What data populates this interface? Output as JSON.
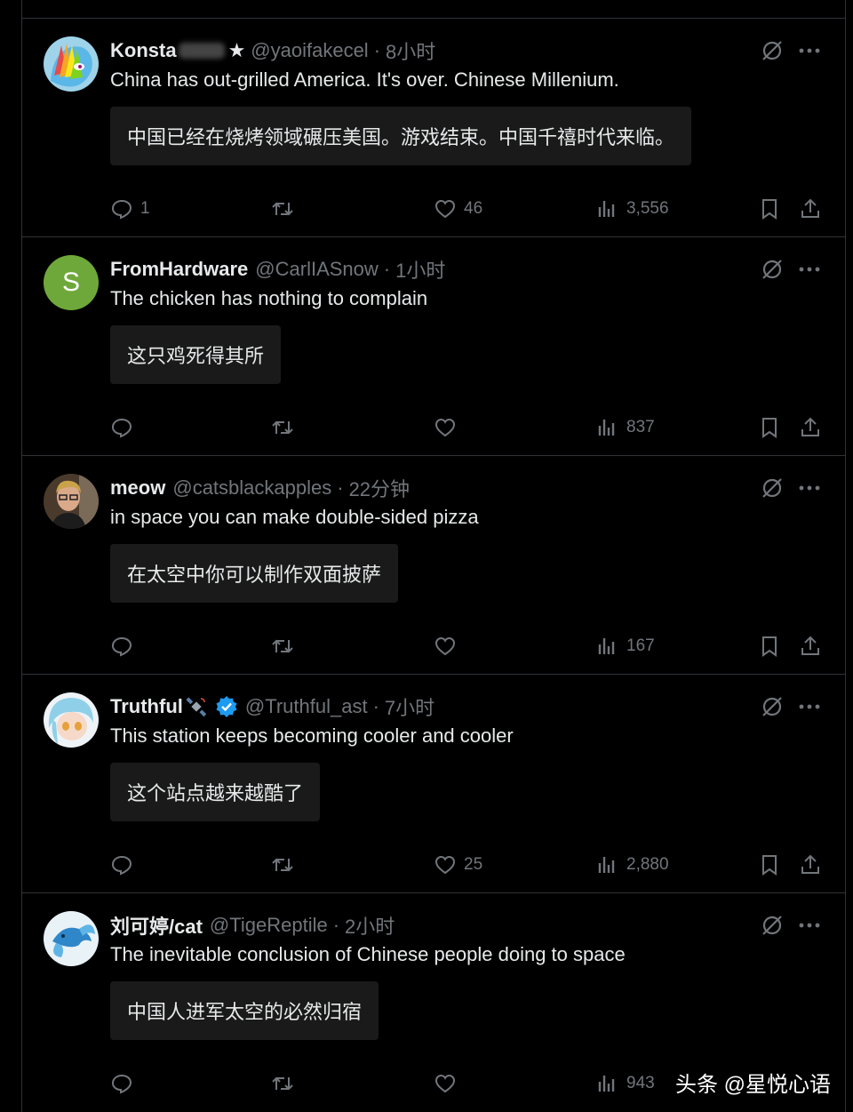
{
  "tweets": [
    {
      "name": "Konsta",
      "handle": "@yaoifakecel",
      "time": "8小时",
      "text": "China has out-grilled America. It's over. Chinese Millenium.",
      "translation": "中国已经在烧烤领域碾压美国。游戏结束。中国千禧时代来临。",
      "replies": "1",
      "likes": "46",
      "views": "3,556"
    },
    {
      "name": "FromHardware",
      "handle": "@CarlIASnow",
      "time": "1小时",
      "avatar_letter": "S",
      "text": "The chicken has nothing to complain",
      "translation": "这只鸡死得其所",
      "replies": "",
      "likes": "",
      "views": "837"
    },
    {
      "name": "meow",
      "handle": "@catsblackapples",
      "time": "22分钟",
      "text": "in space you can make double-sided pizza",
      "translation": "在太空中你可以制作双面披萨",
      "replies": "",
      "likes": "",
      "views": "167"
    },
    {
      "name": "Truthful",
      "handle": "@Truthful_ast",
      "time": "7小时",
      "text": "This station keeps becoming cooler and cooler",
      "translation": "这个站点越来越酷了",
      "replies": "",
      "likes": "25",
      "views": "2,880"
    },
    {
      "name": "刘可婷/cat",
      "handle": "@TigeReptile",
      "time": "2小时",
      "text": "The inevitable conclusion of Chinese people doing to space",
      "translation": "中国人进军太空的必然归宿",
      "replies": "",
      "likes": "",
      "views": "943"
    }
  ],
  "separator": "·",
  "star": "★",
  "watermark": "头条 @星悦心语",
  "colors": {
    "background": "#000000",
    "muted": "#71767b",
    "verified": "#1d9bf0"
  }
}
